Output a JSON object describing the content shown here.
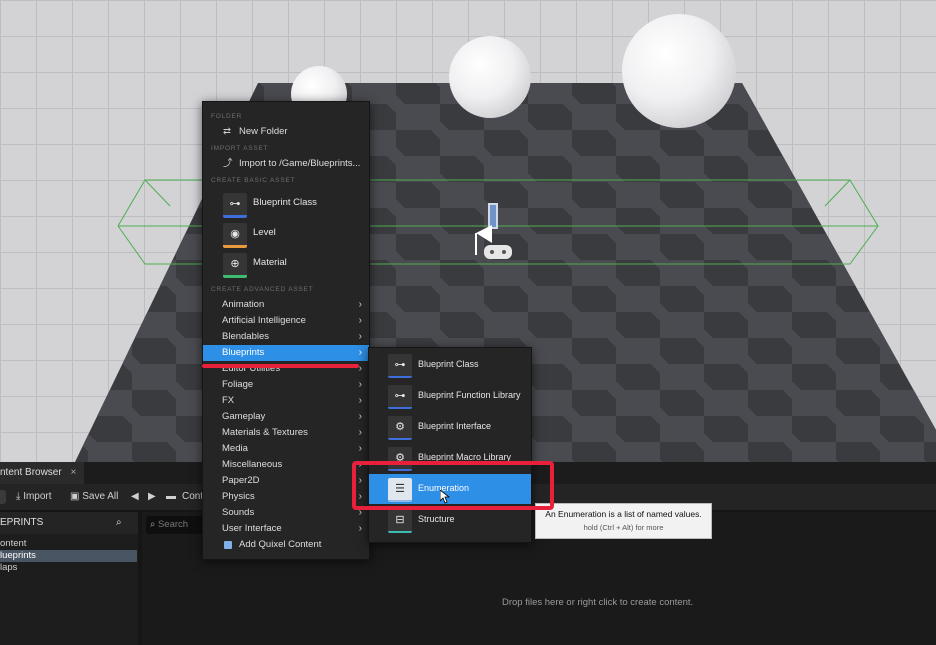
{
  "context_menu": {
    "sections": {
      "folder": "FOLDER",
      "import_asset": "IMPORT ASSET",
      "create_basic_asset": "CREATE BASIC ASSET",
      "create_advanced_asset": "CREATE ADVANCED ASSET"
    },
    "new_folder": "New Folder",
    "import_to": "Import to /Game/Blueprints...",
    "basic_assets": [
      {
        "label": "Blueprint Class",
        "icon": "blueprint-class-icon"
      },
      {
        "label": "Level",
        "icon": "level-icon"
      },
      {
        "label": "Material",
        "icon": "material-icon"
      }
    ],
    "advanced_items": [
      "Animation",
      "Artificial Intelligence",
      "Blendables",
      "Blueprints",
      "Editor Utilities",
      "Foliage",
      "FX",
      "Gameplay",
      "Materials & Textures",
      "Media",
      "Miscellaneous",
      "Paper2D",
      "Physics",
      "Sounds",
      "User Interface"
    ],
    "selected_item": "Blueprints",
    "quixel": "Add Quixel Content"
  },
  "submenu": {
    "items": [
      "Blueprint Class",
      "Blueprint Function Library",
      "Blueprint Interface",
      "Blueprint Macro Library",
      "Enumeration",
      "Structure"
    ],
    "selected_item": "Enumeration"
  },
  "tooltip": {
    "text": "An Enumeration is a list of named values.",
    "hint": "hold (Ctrl + Alt) for more"
  },
  "content_browser": {
    "tab_label": "ntent Browser",
    "toolbar": {
      "import": "Import",
      "save_all": "Save All",
      "cont": "Cont"
    },
    "left_header": "EPRINTS",
    "tree": [
      "ontent",
      "lueprints",
      "laps"
    ],
    "selected_tree": "lueprints",
    "search_placeholder": "Search",
    "empty_hint": "Drop files here or right click to create content."
  },
  "colors": {
    "accent": "#2d8fe6",
    "annotation": "#e8203a",
    "menu_bg": "#252526"
  }
}
